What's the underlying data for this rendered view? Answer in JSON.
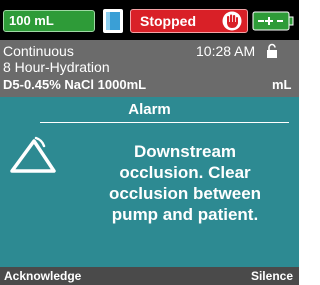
{
  "status_bar": {
    "volume": "100 mL",
    "state": "Stopped",
    "icons": [
      "syringe-icon",
      "stop-hand-icon",
      "battery-plug-icon"
    ],
    "colors": {
      "volume_bg": "#2e9b38",
      "state_bg": "#d92027",
      "bar_bg": "#000000"
    }
  },
  "info": {
    "mode": "Continuous",
    "time": "10:28 AM",
    "program": "8 Hour-Hydration",
    "drug": "D5-0.45% NaCl 1000mL",
    "unit": "mL",
    "icons": [
      "lock-icon"
    ]
  },
  "alarm": {
    "title": "Alarm",
    "message": "Downstream\nocclusion. Clear\nocclusion between\npump and patient.",
    "icon": "warning-triangle-icon",
    "color": "#2d8a92"
  },
  "softkeys": {
    "left": "Acknowledge",
    "right": "Silence"
  }
}
